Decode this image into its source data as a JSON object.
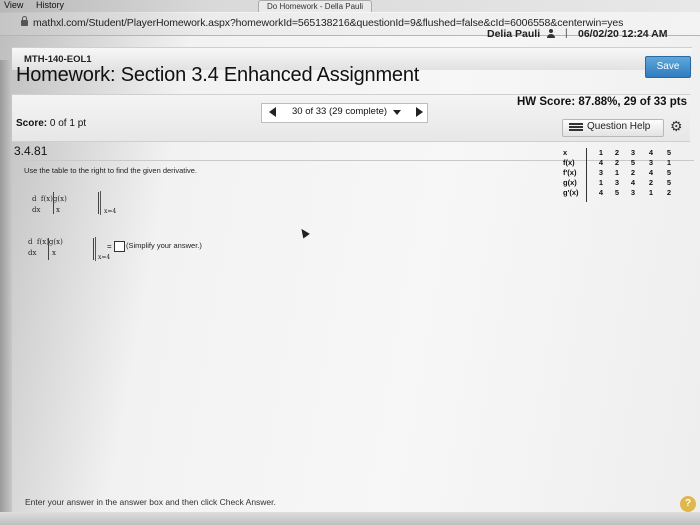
{
  "browser": {
    "menu_view": "View",
    "menu_history": "History",
    "tab_title": "Do Homework - Della Pauli",
    "url": "mathxl.com/Student/PlayerHomework.aspx?homeworkId=565138216&questionId=9&flushed=false&cId=6006558&centerwin=yes"
  },
  "header": {
    "user_name": "Delia Pauli",
    "separator": "|",
    "datetime": "06/02/20 12:24 AM",
    "course_code": "MTH-140-EOL1",
    "save_label": "Save"
  },
  "assignment": {
    "title": "Homework: Section 3.4 Enhanced Assignment",
    "score_prefix": "Score:",
    "score_value": "0 of 1 pt",
    "question_counter": "30 of 33 (29 complete)",
    "hw_score": "HW Score: 87.88%, 29 of 33 pts",
    "question_help_label": "Question Help",
    "question_id": "3.4.81"
  },
  "question": {
    "instructions": "Use the table to the right to find the given derivative.",
    "expr1_top": "d  f(x)g(x)",
    "expr1_bottom": "dx       x",
    "expr_eval": "x=4",
    "expr2_top": "d  f(x)g(x)",
    "expr2_bottom": "dx       x",
    "equals": "=",
    "simplify_note": "(Simplify your answer.)"
  },
  "table": {
    "header_label": "x",
    "columns": [
      "1",
      "2",
      "3",
      "4",
      "5"
    ],
    "rows": [
      {
        "label": "f(x)",
        "values": [
          "4",
          "2",
          "5",
          "3",
          "1"
        ]
      },
      {
        "label": "f'(x)",
        "values": [
          "3",
          "1",
          "2",
          "4",
          "5"
        ]
      },
      {
        "label": "g(x)",
        "values": [
          "1",
          "3",
          "4",
          "2",
          "5"
        ]
      },
      {
        "label": "g'(x)",
        "values": [
          "4",
          "5",
          "3",
          "1",
          "2"
        ]
      }
    ]
  },
  "footer": {
    "instruction": "Enter your answer in the answer box and then click Check Answer.",
    "help_symbol": "?"
  },
  "colors": {
    "save_button": "#2f7cbf",
    "help_circle": "#e0b74d"
  }
}
